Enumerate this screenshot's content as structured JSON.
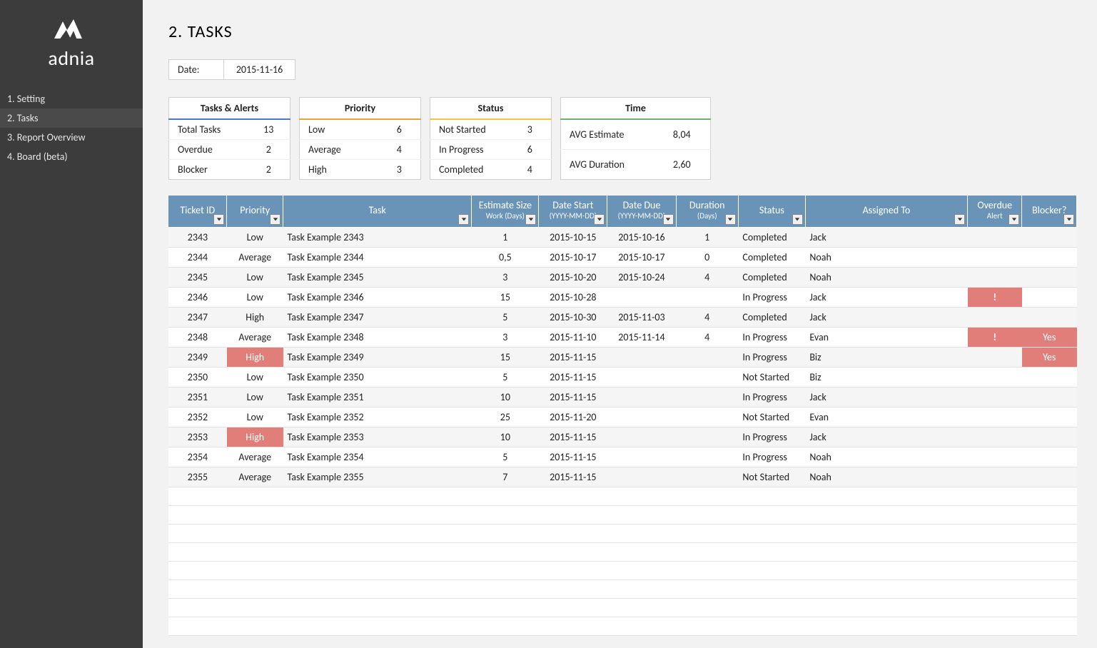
{
  "brand": "adnia",
  "nav": {
    "items": [
      {
        "label": "1. Setting",
        "active": false
      },
      {
        "label": "2. Tasks",
        "active": true
      },
      {
        "label": "3. Report Overview",
        "active": false
      },
      {
        "label": "4. Board (beta)",
        "active": false
      }
    ]
  },
  "page": {
    "title": "2. TASKS"
  },
  "date": {
    "label": "Date:",
    "value": "2015-11-16"
  },
  "summary": {
    "tasks_alerts": {
      "title": "Tasks & Alerts",
      "rows": [
        {
          "label": "Total Tasks",
          "value": "13"
        },
        {
          "label": "Overdue",
          "value": "2"
        },
        {
          "label": "Blocker",
          "value": "2"
        }
      ]
    },
    "priority": {
      "title": "Priority",
      "rows": [
        {
          "label": "Low",
          "value": "6"
        },
        {
          "label": "Average",
          "value": "4"
        },
        {
          "label": "High",
          "value": "3"
        }
      ]
    },
    "status": {
      "title": "Status",
      "rows": [
        {
          "label": "Not Started",
          "value": "3"
        },
        {
          "label": "In Progress",
          "value": "6"
        },
        {
          "label": "Completed",
          "value": "4"
        }
      ]
    },
    "time": {
      "title": "Time",
      "rows": [
        {
          "label": "AVG Estimate",
          "value": "8,04"
        },
        {
          "label": "AVG Duration",
          "value": "2,60"
        }
      ]
    }
  },
  "table": {
    "headers": [
      {
        "text": "Ticket ID"
      },
      {
        "text": "Priority"
      },
      {
        "text": "Task"
      },
      {
        "text": "Estimate Size",
        "sub": "Work (Days)"
      },
      {
        "text": "Date Start",
        "sub": "(YYYY-MM-DD)"
      },
      {
        "text": "Date Due",
        "sub": "(YYYY-MM-DD)"
      },
      {
        "text": "Duration",
        "sub": "(Days)"
      },
      {
        "text": "Status"
      },
      {
        "text": "Assigned To"
      },
      {
        "text": "Overdue",
        "sub": "Alert"
      },
      {
        "text": "Blocker?"
      }
    ],
    "rows": [
      {
        "id": "2343",
        "priority": "Low",
        "pri_hl": false,
        "task": "Task Example 2343",
        "estimate": "1",
        "start": "2015-10-15",
        "due": "2015-10-16",
        "duration": "1",
        "status": "Completed",
        "assigned": "Jack",
        "overdue": "",
        "blocker": ""
      },
      {
        "id": "2344",
        "priority": "Average",
        "pri_hl": false,
        "task": "Task Example 2344",
        "estimate": "0,5",
        "start": "2015-10-17",
        "due": "2015-10-17",
        "duration": "0",
        "status": "Completed",
        "assigned": "Noah",
        "overdue": "",
        "blocker": ""
      },
      {
        "id": "2345",
        "priority": "Low",
        "pri_hl": false,
        "task": "Task Example 2345",
        "estimate": "3",
        "start": "2015-10-20",
        "due": "2015-10-24",
        "duration": "4",
        "status": "Completed",
        "assigned": "Noah",
        "overdue": "",
        "blocker": ""
      },
      {
        "id": "2346",
        "priority": "Low",
        "pri_hl": false,
        "task": "Task Example 2346",
        "estimate": "15",
        "start": "2015-10-28",
        "due": "",
        "duration": "",
        "status": "In Progress",
        "assigned": "Jack",
        "overdue": "!",
        "blocker": ""
      },
      {
        "id": "2347",
        "priority": "High",
        "pri_hl": false,
        "task": "Task Example 2347",
        "estimate": "5",
        "start": "2015-10-30",
        "due": "2015-11-03",
        "duration": "4",
        "status": "Completed",
        "assigned": "Jack",
        "overdue": "",
        "blocker": ""
      },
      {
        "id": "2348",
        "priority": "Average",
        "pri_hl": false,
        "task": "Task Example 2348",
        "estimate": "3",
        "start": "2015-11-10",
        "due": "2015-11-14",
        "duration": "4",
        "status": "In Progress",
        "assigned": "Evan",
        "overdue": "!",
        "blocker": "Yes"
      },
      {
        "id": "2349",
        "priority": "High",
        "pri_hl": true,
        "task": "Task Example 2349",
        "estimate": "15",
        "start": "2015-11-15",
        "due": "",
        "duration": "",
        "status": "In Progress",
        "assigned": "Biz",
        "overdue": "",
        "blocker": "Yes"
      },
      {
        "id": "2350",
        "priority": "Low",
        "pri_hl": false,
        "task": "Task Example 2350",
        "estimate": "5",
        "start": "2015-11-15",
        "due": "",
        "duration": "",
        "status": "Not Started",
        "assigned": "Biz",
        "overdue": "",
        "blocker": ""
      },
      {
        "id": "2351",
        "priority": "Low",
        "pri_hl": false,
        "task": "Task Example 2351",
        "estimate": "10",
        "start": "2015-11-15",
        "due": "",
        "duration": "",
        "status": "In Progress",
        "assigned": "Jack",
        "overdue": "",
        "blocker": ""
      },
      {
        "id": "2352",
        "priority": "Low",
        "pri_hl": false,
        "task": "Task Example 2352",
        "estimate": "25",
        "start": "2015-11-20",
        "due": "",
        "duration": "",
        "status": "Not Started",
        "assigned": "Evan",
        "overdue": "",
        "blocker": ""
      },
      {
        "id": "2353",
        "priority": "High",
        "pri_hl": true,
        "task": "Task Example 2353",
        "estimate": "10",
        "start": "2015-11-15",
        "due": "",
        "duration": "",
        "status": "In Progress",
        "assigned": "Jack",
        "overdue": "",
        "blocker": ""
      },
      {
        "id": "2354",
        "priority": "Average",
        "pri_hl": false,
        "task": "Task Example 2354",
        "estimate": "5",
        "start": "2015-11-15",
        "due": "",
        "duration": "",
        "status": "In Progress",
        "assigned": "Noah",
        "overdue": "",
        "blocker": ""
      },
      {
        "id": "2355",
        "priority": "Average",
        "pri_hl": false,
        "task": "Task Example 2355",
        "estimate": "7",
        "start": "2015-11-15",
        "due": "",
        "duration": "",
        "status": "Not Started",
        "assigned": "Noah",
        "overdue": "",
        "blocker": ""
      }
    ],
    "empty_rows": 8
  }
}
